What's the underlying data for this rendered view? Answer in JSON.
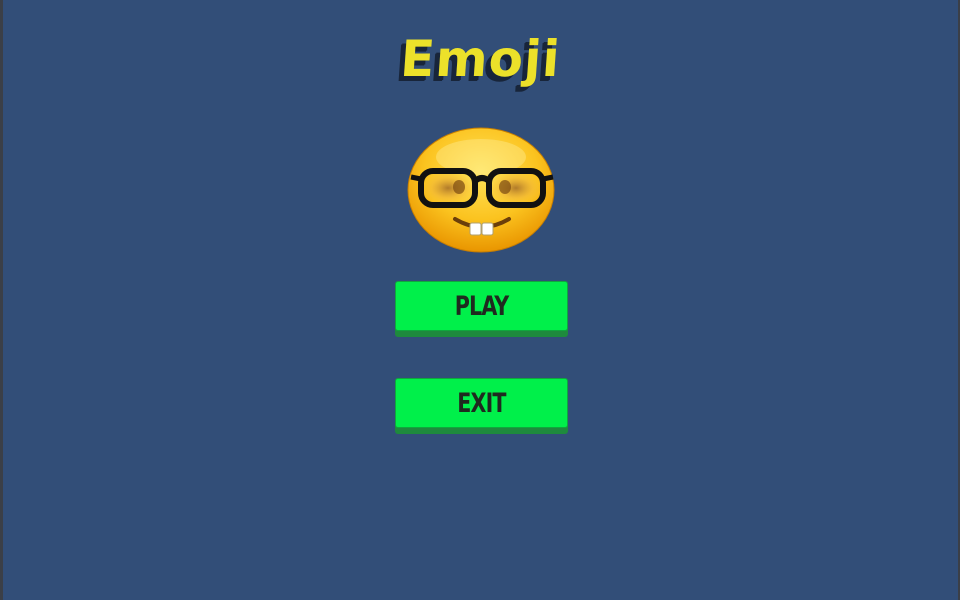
{
  "title": "Emoji",
  "emoji": {
    "icon": "nerd-face-icon"
  },
  "buttons": {
    "play_label": "PLAY",
    "exit_label": "EXIT"
  },
  "colors": {
    "background": "#324e78",
    "title": "#ece12a",
    "button": "#00f04a",
    "button_text": "#1f2a1f"
  }
}
